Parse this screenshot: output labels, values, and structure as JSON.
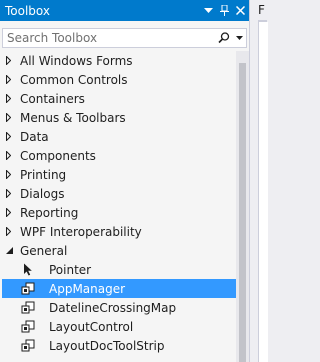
{
  "toolbox": {
    "title": "Toolbox",
    "buttons": {
      "dropdown_icon": "chevron-down-icon",
      "pin_icon": "pin-icon",
      "close_icon": "close-icon"
    }
  },
  "search": {
    "placeholder": "Search Toolbox",
    "icon": "search-icon"
  },
  "categories": [
    {
      "label": "All Windows Forms",
      "expanded": false
    },
    {
      "label": "Common Controls",
      "expanded": false
    },
    {
      "label": "Containers",
      "expanded": false
    },
    {
      "label": "Menus & Toolbars",
      "expanded": false
    },
    {
      "label": "Data",
      "expanded": false
    },
    {
      "label": "Components",
      "expanded": false
    },
    {
      "label": "Printing",
      "expanded": false
    },
    {
      "label": "Dialogs",
      "expanded": false
    },
    {
      "label": "Reporting",
      "expanded": false
    },
    {
      "label": "WPF Interoperability",
      "expanded": false
    },
    {
      "label": "General",
      "expanded": true
    }
  ],
  "general_items": [
    {
      "label": "Pointer",
      "icon": "pointer-icon",
      "selected": false
    },
    {
      "label": "AppManager",
      "icon": "component-icon",
      "selected": true
    },
    {
      "label": "DatelineCrossingMap",
      "icon": "component-icon",
      "selected": false
    },
    {
      "label": "LayoutControl",
      "icon": "component-icon",
      "selected": false
    },
    {
      "label": "LayoutDocToolStrip",
      "icon": "component-icon",
      "selected": false
    }
  ],
  "document_tab": {
    "label": "F"
  },
  "colors": {
    "titlebar": "#007acc",
    "selection": "#3399ff",
    "panel": "#f5f5f5"
  }
}
